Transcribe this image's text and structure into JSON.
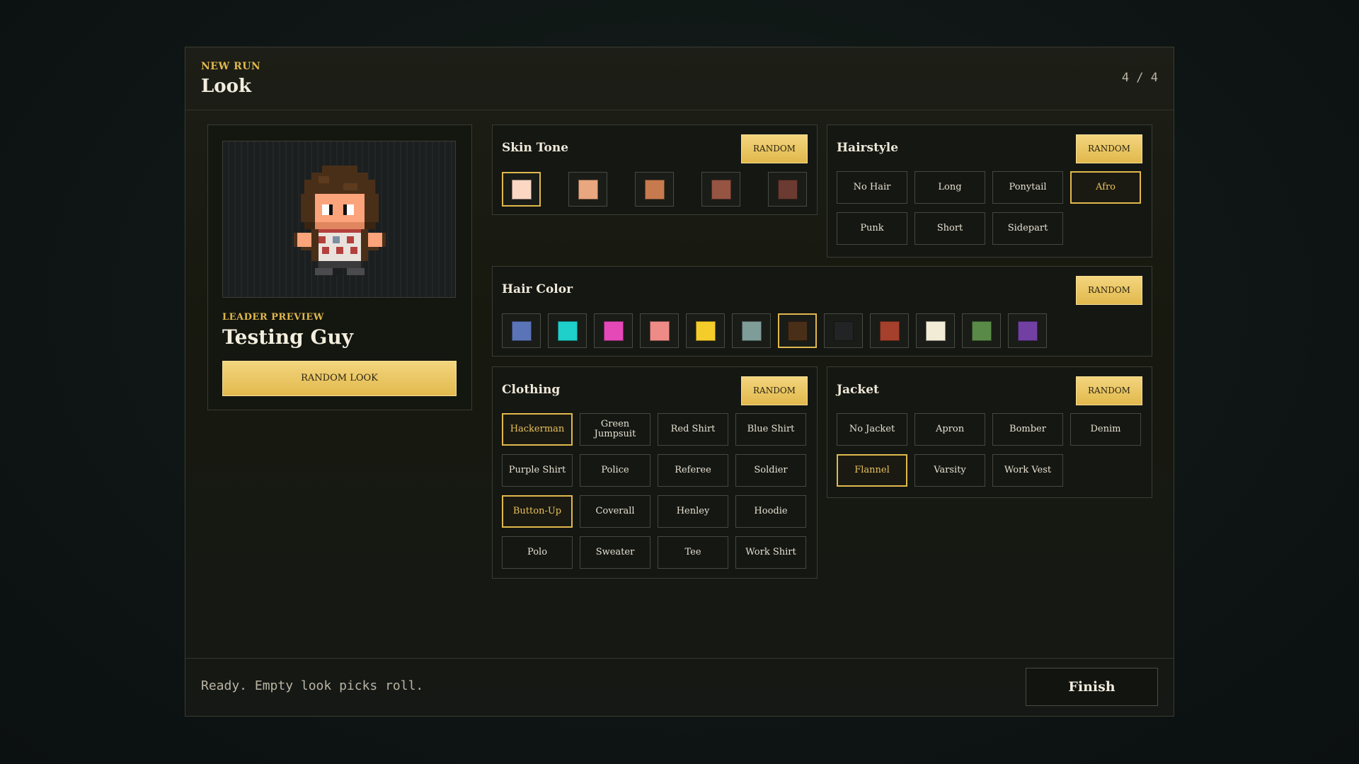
{
  "header": {
    "eyebrow": "NEW RUN",
    "title": "Look",
    "step": "4 / 4"
  },
  "preview": {
    "label": "LEADER PREVIEW",
    "name": "Testing Guy",
    "random_look_label": "RANDOM LOOK"
  },
  "skin_tone": {
    "title": "Skin Tone",
    "random_label": "RANDOM",
    "selected_index": 0,
    "swatches": [
      "#fcd7c4",
      "#e9a77f",
      "#c77a4e",
      "#965443",
      "#6b3a31"
    ]
  },
  "hairstyle": {
    "title": "Hairstyle",
    "random_label": "RANDOM",
    "options": [
      {
        "label": "No Hair",
        "selected": false
      },
      {
        "label": "Long",
        "selected": false
      },
      {
        "label": "Ponytail",
        "selected": false
      },
      {
        "label": "Afro",
        "selected": true
      },
      {
        "label": "Punk",
        "selected": false
      },
      {
        "label": "Short",
        "selected": false
      },
      {
        "label": "Sidepart",
        "selected": false
      }
    ]
  },
  "hair_color": {
    "title": "Hair Color",
    "random_label": "RANDOM",
    "selected_index": 6,
    "swatches": [
      "#5b74b7",
      "#1fcfca",
      "#e548b7",
      "#ef8b86",
      "#f5cd2b",
      "#7e9c98",
      "#4a2f18",
      "#222325",
      "#a5402c",
      "#f2ecd7",
      "#5a8a48",
      "#7240a3"
    ]
  },
  "clothing": {
    "title": "Clothing",
    "random_label": "RANDOM",
    "options": [
      {
        "label": "Hackerman",
        "selected": true
      },
      {
        "label": "Green Jumpsuit",
        "selected": false
      },
      {
        "label": "Red Shirt",
        "selected": false
      },
      {
        "label": "Blue Shirt",
        "selected": false
      },
      {
        "label": "Purple Shirt",
        "selected": false
      },
      {
        "label": "Police",
        "selected": false
      },
      {
        "label": "Referee",
        "selected": false
      },
      {
        "label": "Soldier",
        "selected": false
      },
      {
        "label": "Button-Up",
        "selected": true
      },
      {
        "label": "Coverall",
        "selected": false
      },
      {
        "label": "Henley",
        "selected": false
      },
      {
        "label": "Hoodie",
        "selected": false
      },
      {
        "label": "Polo",
        "selected": false
      },
      {
        "label": "Sweater",
        "selected": false
      },
      {
        "label": "Tee",
        "selected": false
      },
      {
        "label": "Work Shirt",
        "selected": false
      }
    ]
  },
  "jacket": {
    "title": "Jacket",
    "random_label": "RANDOM",
    "options": [
      {
        "label": "No Jacket",
        "selected": false
      },
      {
        "label": "Apron",
        "selected": false
      },
      {
        "label": "Bomber",
        "selected": false
      },
      {
        "label": "Denim",
        "selected": false
      },
      {
        "label": "Flannel",
        "selected": true
      },
      {
        "label": "Varsity",
        "selected": false
      },
      {
        "label": "Work Vest",
        "selected": false
      }
    ]
  },
  "footer": {
    "status": "Ready. Empty look picks roll.",
    "finish_label": "Finish"
  },
  "colors": {
    "accent": "#e0b84d",
    "panel_bg": "#17190f"
  }
}
